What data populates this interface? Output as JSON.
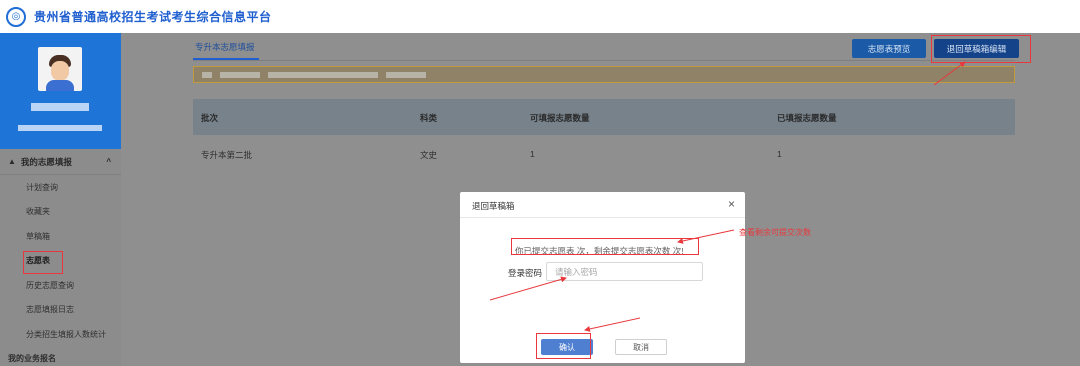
{
  "header": {
    "logo_glyph": "◎",
    "title": "贵州省普通高校招生考试考生综合信息平台"
  },
  "sidebar": {
    "group": {
      "icon": "person-icon",
      "label": "我的志愿填报",
      "caret": "^"
    },
    "items": [
      {
        "label": "计划查询"
      },
      {
        "label": "收藏夹"
      },
      {
        "label": "草稿箱"
      },
      {
        "label": "志愿表",
        "active": true
      },
      {
        "label": "历史志愿查询"
      },
      {
        "label": "志愿填报日志"
      },
      {
        "label": "分类招生填报人数统计"
      }
    ],
    "next_group_label": "我的业务报名"
  },
  "main": {
    "tab_label": "专升本志愿填报",
    "buttons": {
      "preview": "志愿表预览",
      "withdraw": "退回草稿箱编辑"
    },
    "table": {
      "headers": [
        "批次",
        "科类",
        "可填报志愿数量",
        "已填报志愿数量"
      ],
      "rows": [
        [
          "专升本第二批",
          "文史",
          "1",
          "1"
        ]
      ]
    }
  },
  "dialog": {
    "title": "退回草稿箱",
    "close": "×",
    "message": "你已提交志愿表  次，剩余提交志愿表次数  次!",
    "password_label": "登录密码",
    "password_placeholder": "请输入密码",
    "confirm": "确认",
    "cancel": "取消"
  },
  "annotation": "查看剩余可提交次数",
  "colors": {
    "brand": "#1f5fcf",
    "highlight": "#e8383d",
    "primary_button": "#4f7fd0"
  }
}
